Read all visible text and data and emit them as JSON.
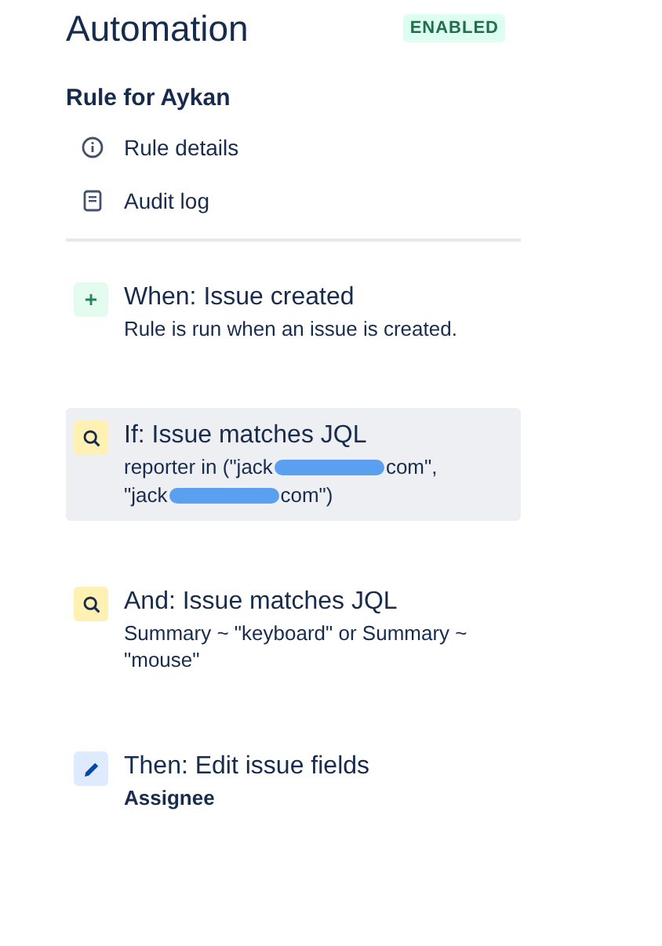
{
  "header": {
    "title": "Automation",
    "status_badge": "ENABLED"
  },
  "rule": {
    "name": "Rule for Aykan",
    "nav_items": [
      {
        "kind": "info",
        "label": "Rule details"
      },
      {
        "kind": "log",
        "label": "Audit log"
      }
    ]
  },
  "steps": [
    {
      "kind": "trigger",
      "title": "When: Issue created",
      "selected": false,
      "bold_detail": false,
      "detail_lines": [
        [
          {
            "kind": "text",
            "text": "Rule is run when an issue is created."
          }
        ]
      ]
    },
    {
      "kind": "condition",
      "title": "If: Issue matches JQL",
      "selected": true,
      "bold_detail": false,
      "detail_lines": [
        [
          {
            "kind": "text",
            "text": "reporter in (\"jack"
          },
          {
            "kind": "redacted"
          },
          {
            "kind": "text",
            "text": "com\","
          }
        ],
        [
          {
            "kind": "text",
            "text": "\"jack"
          },
          {
            "kind": "redacted"
          },
          {
            "kind": "text",
            "text": "com\")"
          }
        ]
      ]
    },
    {
      "kind": "condition",
      "title": "And: Issue matches JQL",
      "selected": false,
      "bold_detail": false,
      "detail_lines": [
        [
          {
            "kind": "text",
            "text": "Summary ~ \"keyboard\" or Summary ~ \"mouse\""
          }
        ]
      ]
    },
    {
      "kind": "action",
      "title": "Then: Edit issue fields",
      "selected": false,
      "bold_detail": true,
      "detail_lines": [
        [
          {
            "kind": "text",
            "text": "Assignee"
          }
        ]
      ]
    }
  ]
}
